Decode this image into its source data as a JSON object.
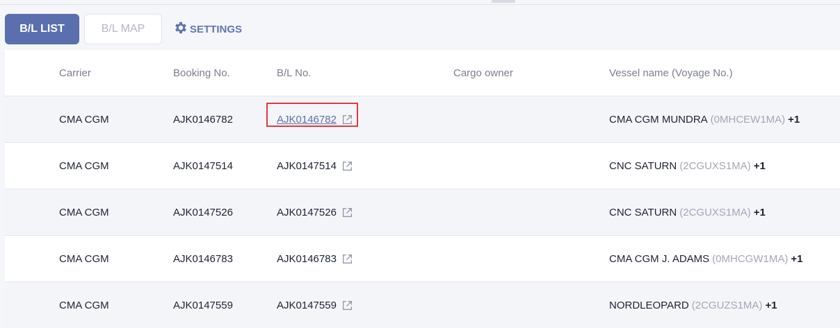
{
  "tabs": {
    "list_label": "B/L LIST",
    "map_label": "B/L MAP",
    "settings_label": "SETTINGS"
  },
  "table": {
    "columns": [
      "Carrier",
      "Booking No.",
      "B/L No.",
      "Cargo owner",
      "Vessel name (Voyage No.)"
    ],
    "rows": [
      {
        "carrier": "CMA CGM",
        "booking": "AJK0146782",
        "bl": "AJK0146782",
        "owner": "",
        "vessel": "CMA CGM MUNDRA",
        "voyage": "(0MHCEW1MA)",
        "more": "+1"
      },
      {
        "carrier": "CMA CGM",
        "booking": "AJK0147514",
        "bl": "AJK0147514",
        "owner": "",
        "vessel": "CNC SATURN",
        "voyage": "(2CGUXS1MA)",
        "more": "+1"
      },
      {
        "carrier": "CMA CGM",
        "booking": "AJK0147526",
        "bl": "AJK0147526",
        "owner": "",
        "vessel": "CNC SATURN",
        "voyage": "(2CGUXS1MA)",
        "more": "+1"
      },
      {
        "carrier": "CMA CGM",
        "booking": "AJK0146783",
        "bl": "AJK0146783",
        "owner": "",
        "vessel": "CMA CGM J. ADAMS",
        "voyage": "(0MHCGW1MA)",
        "more": "+1"
      },
      {
        "carrier": "CMA CGM",
        "booking": "AJK0147559",
        "bl": "AJK0147559",
        "owner": "",
        "vessel": "NORDLEOPARD",
        "voyage": "(2CGUZS1MA)",
        "more": "+1"
      }
    ]
  },
  "colors": {
    "accent": "#5a6fae",
    "highlight": "#e0393e",
    "muted": "#a3a7b3"
  },
  "icons": {
    "settings": "gear-icon",
    "external": "external-link-icon"
  }
}
